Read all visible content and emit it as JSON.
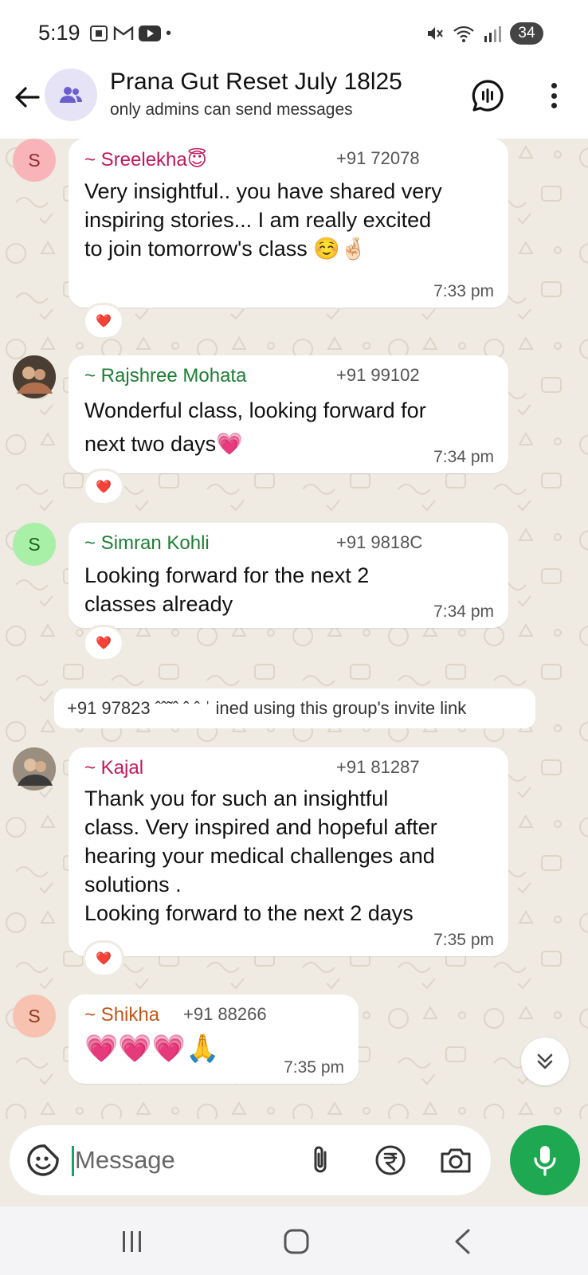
{
  "status_bar": {
    "time": "5:19",
    "battery": "34"
  },
  "header": {
    "title": "Prana Gut Reset July 18l25",
    "subtitle": "only admins can send messages"
  },
  "messages": [
    {
      "avatar_letter": "S",
      "avatar_color": "#f8b4b8",
      "sender": "~ Sreelekha😇",
      "sender_color": "#c2185b",
      "phone": "+91 72078",
      "text": "Very insightful.. you have shared very\ninspiring stories... I am really excited\nto join tomorrow's class ☺️🤞🏻",
      "time": "7:33 pm",
      "reaction": "❤️"
    },
    {
      "avatar_letter": "",
      "avatar_color": "#6b5a4a",
      "sender": "~ Rajshree Mohata",
      "sender_color": "#1e7e34",
      "phone": "+91 99102",
      "text": "Wonderful class, looking forward for\nnext two days💗",
      "time": "7:34 pm",
      "reaction": "❤️"
    },
    {
      "avatar_letter": "S",
      "avatar_color": "#a8f0a8",
      "sender": "~ Simran Kohli",
      "sender_color": "#1e7e34",
      "phone": "+91 9818C",
      "text": "Looking forward for the next 2\nclasses already",
      "time": "7:34 pm",
      "reaction": "❤️"
    },
    {
      "avatar_letter": "",
      "avatar_color": "#8a7f75",
      "sender": "~ Kajal",
      "sender_color": "#c2185b",
      "phone": "+91 81287",
      "text": "Thank you for such an insightful\nclass. Very inspired and hopeful after\nhearing your medical challenges and\nsolutions .\nLooking forward to the next 2 days",
      "time": "7:35 pm",
      "reaction": "❤️"
    },
    {
      "avatar_letter": "S",
      "avatar_color": "#f8c2b0",
      "sender": "~ Shikha",
      "sender_color": "#c0571b",
      "phone": "+91 88266",
      "text": "💗💗💗🙏",
      "time": "7:35 pm"
    }
  ],
  "system_message": "+91 97823 ˆˆ˜ˆ ˆ ˆ ˈ ined using this group's invite link",
  "composer": {
    "placeholder": "Message"
  }
}
